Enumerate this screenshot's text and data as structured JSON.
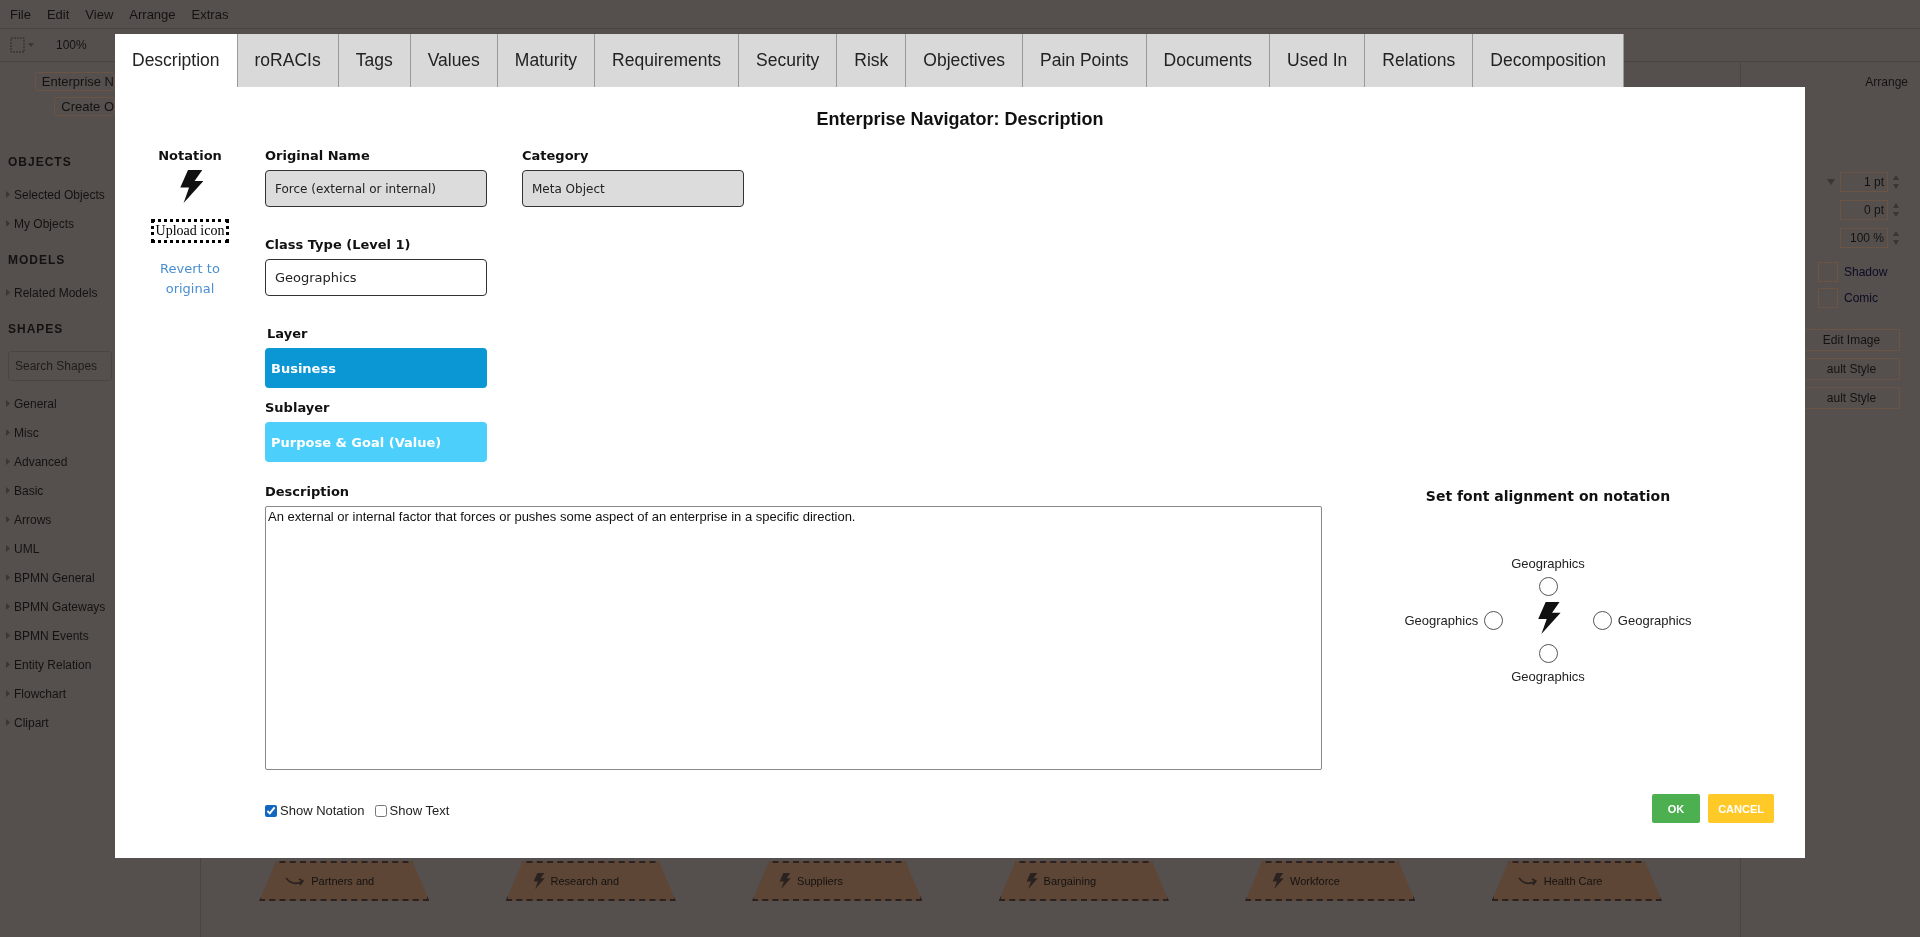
{
  "menu": [
    "File",
    "Edit",
    "View",
    "Arrange",
    "Extras"
  ],
  "toolbar": {
    "zoom": "100%"
  },
  "sidebar": {
    "buttons": [
      "Enterprise N",
      "Create O"
    ],
    "sections": [
      {
        "title": "OBJECTS",
        "items": [
          "Selected Objects",
          "My Objects"
        ]
      },
      {
        "title": "MODELS",
        "items": [
          "Related Models"
        ]
      },
      {
        "title": "SHAPES",
        "search_placeholder": "Search Shapes",
        "items": [
          "General",
          "Misc",
          "Advanced",
          "Basic",
          "Arrows",
          "UML",
          "BPMN General",
          "BPMN Gateways",
          "BPMN Events",
          "Entity Relation",
          "Flowchart",
          "Clipart"
        ]
      }
    ]
  },
  "canvas": {
    "shapes": [
      {
        "label": "Partners and",
        "kind": "arrow"
      },
      {
        "label": "Research and",
        "kind": "bolt"
      },
      {
        "label": "Suppliers",
        "kind": "bolt"
      },
      {
        "label": "Bargaining",
        "kind": "bolt"
      },
      {
        "label": "Workforce",
        "kind": "bolt"
      },
      {
        "label": "Health Care",
        "kind": "arrow"
      }
    ]
  },
  "format_panel": {
    "tab": "Arrange",
    "spinners": [
      "1 pt",
      "0 pt",
      "100 %"
    ],
    "checkboxes": [
      {
        "label": "Shadow",
        "checked": false
      },
      {
        "label": "Comic",
        "checked": false
      }
    ],
    "buttons": [
      "Edit Image",
      "ault Style",
      "ault Style"
    ]
  },
  "dialog": {
    "tabs": [
      {
        "label": "Description",
        "selected": true
      },
      {
        "label": "roRACIs",
        "selected": false
      },
      {
        "label": "Tags",
        "selected": false
      },
      {
        "label": "Values",
        "selected": false
      },
      {
        "label": "Maturity",
        "selected": false
      },
      {
        "label": "Requirements",
        "selected": false
      },
      {
        "label": "Security",
        "selected": false
      },
      {
        "label": "Risk",
        "selected": false
      },
      {
        "label": "Objectives",
        "selected": false
      },
      {
        "label": "Pain Points",
        "selected": false
      },
      {
        "label": "Documents",
        "selected": false
      },
      {
        "label": "Used In",
        "selected": false
      },
      {
        "label": "Relations",
        "selected": false
      },
      {
        "label": "Decomposition",
        "selected": false
      }
    ],
    "title": "Enterprise Navigator: Description",
    "notation": {
      "label": "Notation",
      "upload_button": "Upload icon",
      "revert_link": "Revert to original"
    },
    "original_name": {
      "label": "Original Name",
      "value": "Force (external or internal)",
      "disabled": true
    },
    "category": {
      "label": "Category",
      "value": "Meta Object",
      "disabled": true
    },
    "class_type": {
      "label": "Class Type (Level 1)",
      "value": "Geographics",
      "disabled": false
    },
    "layer": {
      "label": "Layer",
      "value": "Business"
    },
    "sublayer": {
      "label": "Sublayer",
      "value": "Purpose & Goal (Value)"
    },
    "description": {
      "label": "Description",
      "value": "An external or internal factor that forces or pushes some aspect of an enterprise in a specific direction."
    },
    "alignment": {
      "title": "Set font alignment on notation",
      "options": [
        {
          "kind": "top",
          "label": "Geographics",
          "selected": false
        },
        {
          "kind": "left",
          "label": "Geographics",
          "selected": false
        },
        {
          "kind": "right",
          "label": "Geographics",
          "selected": false
        },
        {
          "kind": "bottom",
          "label": "Geographics",
          "selected": false
        }
      ]
    },
    "checkboxes": [
      {
        "label": "Show Notation",
        "checked": true
      },
      {
        "label": "Show Text",
        "checked": false
      }
    ],
    "ok_button": "OK",
    "cancel_button": "CANCEL"
  }
}
